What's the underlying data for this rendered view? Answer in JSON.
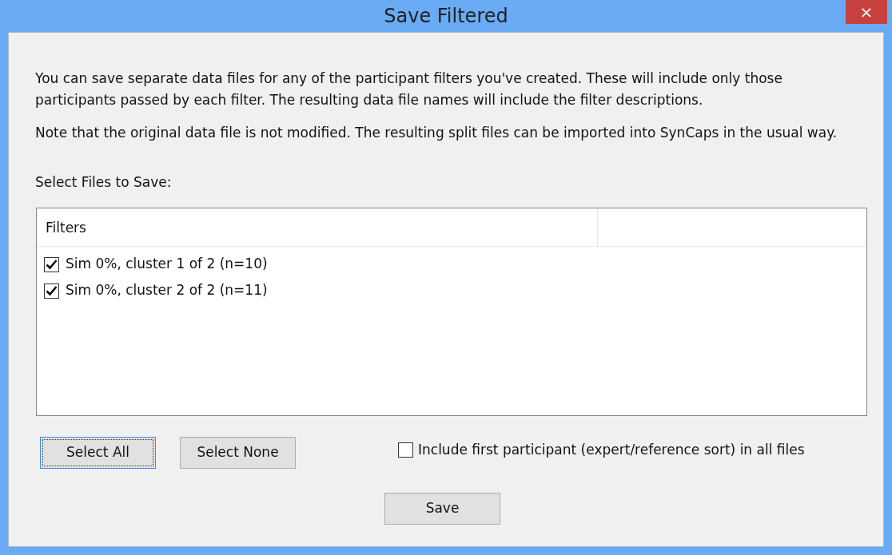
{
  "window": {
    "title": "Save Filtered",
    "close": "×"
  },
  "intro": "You can save separate data files for any of the participant filters you've created. These will include only those participants  passed by each filter. The resulting data file names will include the filter descriptions.",
  "note": "Note that the original data file is not modified. The resulting split files can be imported into SynCaps in the usual way.",
  "list_label": "Select Files to Save:",
  "list": {
    "columns": [
      "Filters"
    ],
    "rows": [
      {
        "label": "Sim 0%, cluster 1 of 2 (n=10)",
        "checked": true
      },
      {
        "label": "Sim 0%, cluster 2 of 2 (n=11)",
        "checked": true
      }
    ]
  },
  "buttons": [
    {
      "label": "Select All",
      "focused": true
    },
    {
      "label": "Select None",
      "focused": false
    }
  ],
  "include_first": {
    "label": "Include first participant (expert/reference sort) in all files",
    "checked": false
  },
  "save_button": {
    "label": "Save",
    "focused": false
  }
}
